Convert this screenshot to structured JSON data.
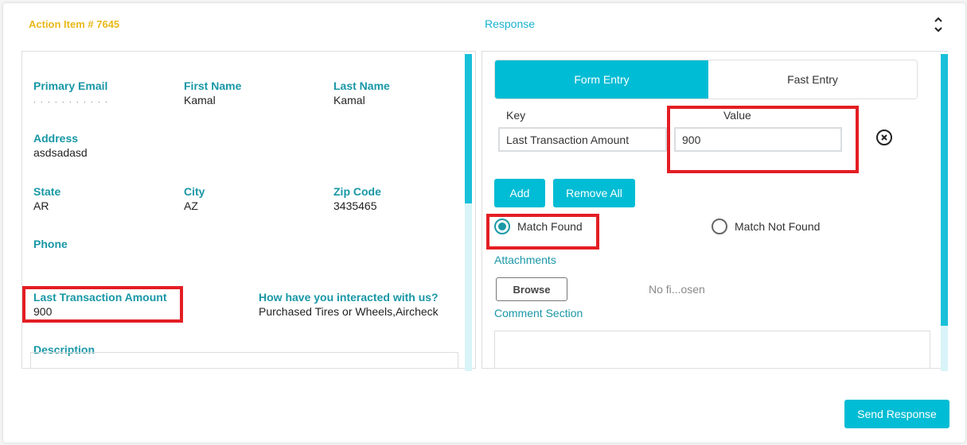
{
  "header": {
    "title": "Action Item # 7645",
    "response_title": "Response"
  },
  "details": {
    "primary_email": {
      "label": "Primary Email",
      "value": ". . . . . . . . . . ."
    },
    "first_name": {
      "label": "First Name",
      "value": "Kamal"
    },
    "last_name": {
      "label": "Last Name",
      "value": "Kamal"
    },
    "address": {
      "label": "Address",
      "value": "asdsadasd"
    },
    "state": {
      "label": "State",
      "value": "AR"
    },
    "city": {
      "label": "City",
      "value": "AZ"
    },
    "zip": {
      "label": "Zip Code",
      "value": "3435465"
    },
    "phone": {
      "label": "Phone",
      "value": ""
    },
    "last_txn": {
      "label": "Last Transaction Amount",
      "value": "900"
    },
    "interaction": {
      "label": "How have you interacted with us?",
      "value": "Purchased Tires or Wheels,Aircheck"
    },
    "description": {
      "label": "Description",
      "value": ""
    }
  },
  "response": {
    "tabs": [
      {
        "label": "Form Entry",
        "active": true
      },
      {
        "label": "Fast Entry",
        "active": false
      }
    ],
    "key_label": "Key",
    "value_label": "Value",
    "key_value": "Last Transaction Amount",
    "value_value": "900",
    "add_label": "Add",
    "remove_all_label": "Remove All",
    "radio_match_found": "Match Found",
    "radio_match_not_found": "Match Not Found",
    "selected_radio": "Match Found",
    "attachments_label": "Attachments",
    "browse_label": "Browse",
    "no_file_text": "No fi...osen",
    "comment_label": "Comment Section",
    "comment_value": "",
    "send_label": "Send Response"
  },
  "colors": {
    "accent": "#00bcd4",
    "label": "#1997a6",
    "title": "#e8b81a",
    "highlight": "#e31e24"
  }
}
